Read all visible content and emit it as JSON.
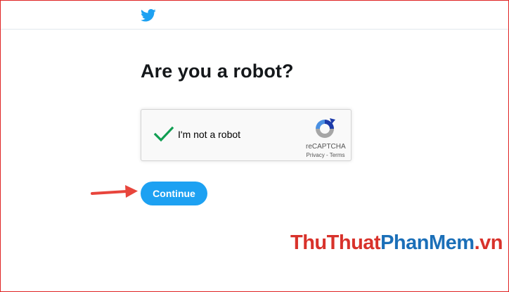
{
  "header": {
    "logo_icon": "twitter-bird-icon",
    "brand_color": "#1da1f2"
  },
  "main": {
    "title": "Are you a robot?"
  },
  "recaptcha": {
    "checkbox_state": "checked",
    "check_color": "#109e52",
    "label": "I'm not a robot",
    "brand": "reCAPTCHA",
    "privacy_link": "Privacy",
    "separator": " - ",
    "terms_link": "Terms"
  },
  "continue_button": {
    "label": "Continue",
    "color": "#1da1f2"
  },
  "annotation": {
    "arrow_icon": "red-arrow-icon",
    "arrow_color": "#e8453c"
  },
  "watermark": {
    "part1": "ThuThuat",
    "part2": "PhanMem",
    "part3": ".vn"
  }
}
